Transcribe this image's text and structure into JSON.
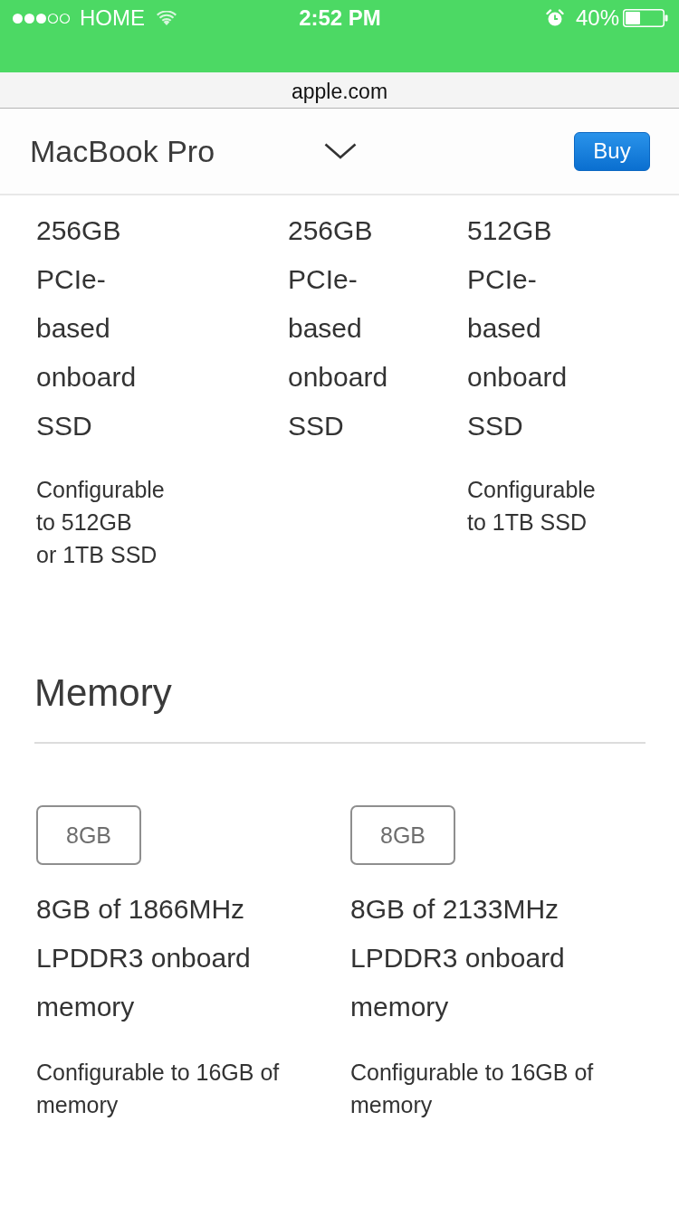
{
  "status_bar": {
    "carrier": "HOME",
    "time": "2:52 PM",
    "battery": "40%"
  },
  "address_bar": {
    "url": "apple.com"
  },
  "nav": {
    "title": "MacBook Pro",
    "buy_button": "Buy"
  },
  "storage": {
    "columns": [
      {
        "spec": "256GB PCIe-based onboard SSD",
        "note": "Configurable\nto 512GB\nor 1TB SSD"
      },
      {
        "spec": "256GB PCIe-based onboard SSD"
      },
      {
        "spec": "512GB PCIe-based onboard SSD",
        "note": "Configurable\nto 1TB SSD"
      }
    ]
  },
  "memory": {
    "heading": "Memory",
    "options": [
      {
        "size": "8GB",
        "spec": "8GB of 1866MHz LPDDR3 onboard memory",
        "note": "Configurable to 16GB of memory"
      },
      {
        "size": "8GB",
        "spec": "8GB of 2133MHz LPDDR3 onboard memory",
        "note": "Configurable to 16GB of memory"
      }
    ]
  }
}
